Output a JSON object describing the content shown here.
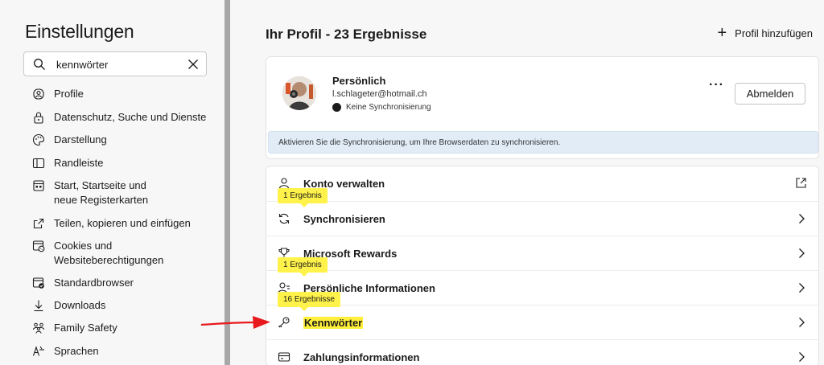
{
  "sidebar": {
    "title": "Einstellungen",
    "search": {
      "value": "kennwörter",
      "placeholder": ""
    },
    "items": [
      {
        "label": "Profile",
        "icon": "profile-icon"
      },
      {
        "label": "Datenschutz, Suche und Dienste",
        "icon": "lock-icon"
      },
      {
        "label": "Darstellung",
        "icon": "palette-icon"
      },
      {
        "label": "Randleiste",
        "icon": "sidebar-icon"
      },
      {
        "label": "Start, Startseite und neue Registerkarten",
        "icon": "home-grid-icon"
      },
      {
        "label": "Teilen, kopieren und einfügen",
        "icon": "share-icon"
      },
      {
        "label": "Cookies und Websiteberechtigungen",
        "icon": "cookies-icon"
      },
      {
        "label": "Standardbrowser",
        "icon": "browser-icon"
      },
      {
        "label": "Downloads",
        "icon": "download-icon"
      },
      {
        "label": "Family Safety",
        "icon": "family-icon"
      },
      {
        "label": "Sprachen",
        "icon": "languages-icon"
      }
    ]
  },
  "main": {
    "title": "Ihr Profil - 23 Ergebnisse",
    "add_profile_label": "Profil hinzufügen",
    "profile": {
      "name": "Persönlich",
      "email": "l.schlageter@hotmail.ch",
      "sync_status": "Keine Synchronisierung",
      "more_label": "···",
      "signout_label": "Abmelden",
      "banner": "Aktivieren Sie die Synchronisierung, um Ihre Browserdaten zu synchronisieren."
    },
    "rows": [
      {
        "label": "Konto verwalten",
        "icon": "person-icon",
        "trail": "external"
      },
      {
        "label": "Synchronisieren",
        "icon": "sync-icon",
        "trail": "chevron"
      },
      {
        "label": "Microsoft Rewards",
        "icon": "trophy-icon",
        "trail": "chevron"
      },
      {
        "label": "Persönliche Informationen",
        "icon": "person-card-icon",
        "trail": "chevron"
      },
      {
        "label": "Kennwörter",
        "icon": "key-icon",
        "trail": "chevron",
        "highlighted": true
      },
      {
        "label": "Zahlungsinformationen",
        "icon": "card-icon",
        "trail": "chevron"
      }
    ],
    "badges": [
      {
        "label": "1 Ergebnis"
      },
      {
        "label": "1 Ergebnis"
      },
      {
        "label": "16 Ergebnisse"
      }
    ]
  },
  "colors": {
    "highlight": "#ffef3a",
    "banner_bg": "#e1ecf7",
    "arrow": "#e8191c"
  }
}
